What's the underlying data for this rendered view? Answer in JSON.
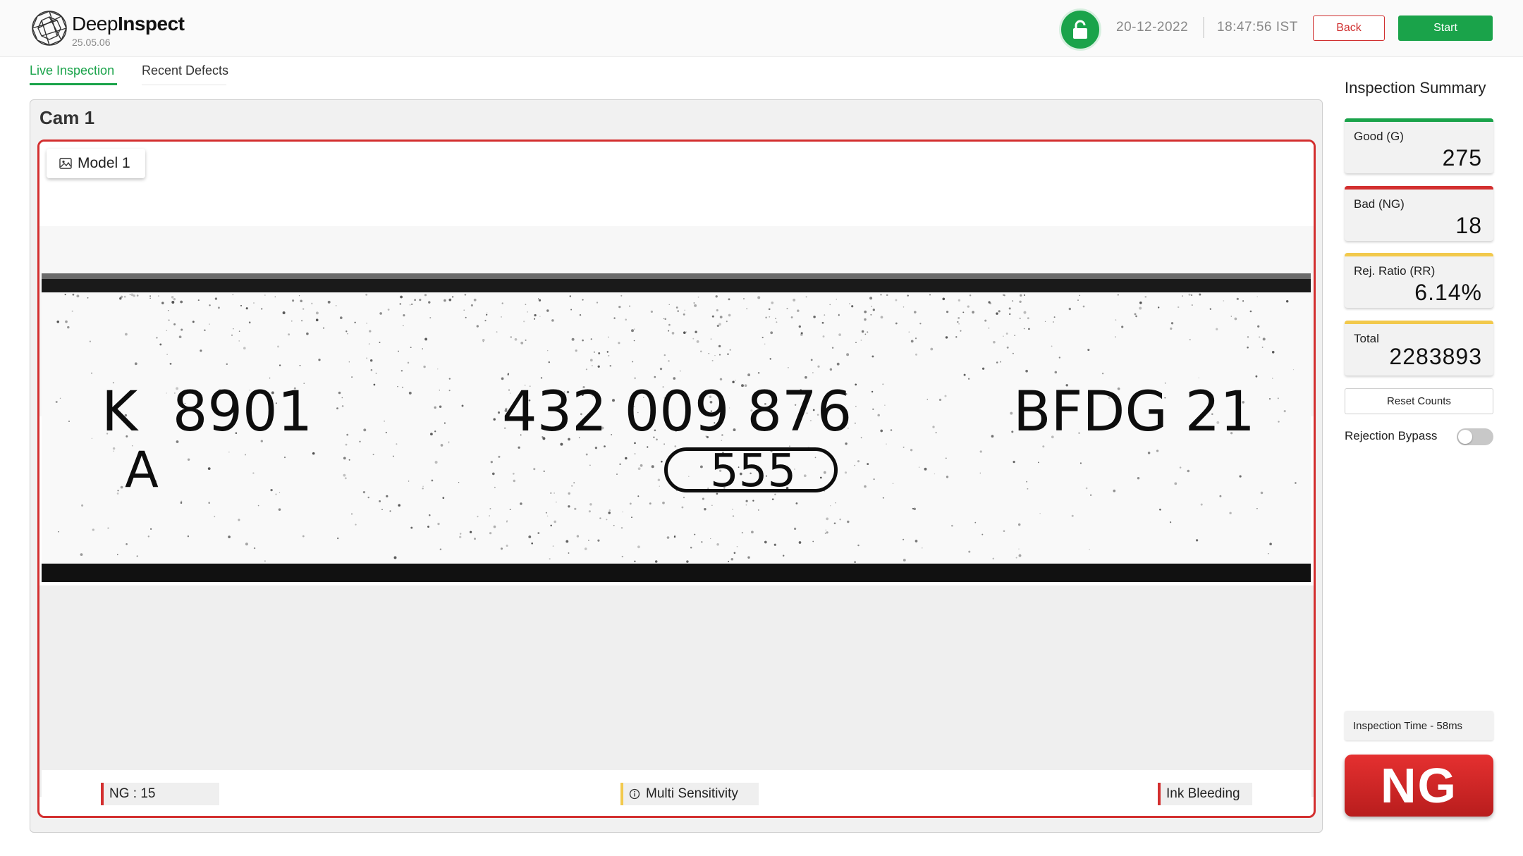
{
  "header": {
    "brand_light": "Deep",
    "brand_bold": "Inspect",
    "version": "25.05.06",
    "date": "20-12-2022",
    "time": "18:47:56 IST",
    "back_label": "Back",
    "start_label": "Start",
    "lock_icon": "lock-icon",
    "lock_color": "#1aa34a"
  },
  "tabs": [
    {
      "label": "Live Inspection",
      "active": true
    },
    {
      "label": "Recent Defects",
      "active": false
    }
  ],
  "camera": {
    "title": "Cam 1",
    "model_label": "Model 1",
    "frame_color": "#d32f2f",
    "image_text": {
      "left_code": "K  8901",
      "left_sub": "A",
      "center_code": "432 009 876",
      "center_oval": "555",
      "right_code": "BFDG 21"
    }
  },
  "status_bar": {
    "ng_count": "NG : 15",
    "mode": "Multi Sensitivity",
    "defect": "Ink Bleeding",
    "mode_icon": "info-icon"
  },
  "summary": {
    "title": "Inspection Summary",
    "cards": [
      {
        "label": "Good (G)",
        "value": "275",
        "color": "#1aa34a"
      },
      {
        "label": "Bad (NG)",
        "value": "18",
        "color": "#d32f2f"
      },
      {
        "label": "Rej. Ratio (RR)",
        "value": "6.14%",
        "color": "#f2c94c"
      },
      {
        "label": "Total",
        "value": "2283893",
        "color": "#f2c94c"
      }
    ],
    "reset_label": "Reset Counts",
    "bypass_label": "Rejection Bypass",
    "bypass_on": false,
    "inspection_time": "Inspection Time - 58ms",
    "result": "NG",
    "result_color": "#d32f2f"
  }
}
